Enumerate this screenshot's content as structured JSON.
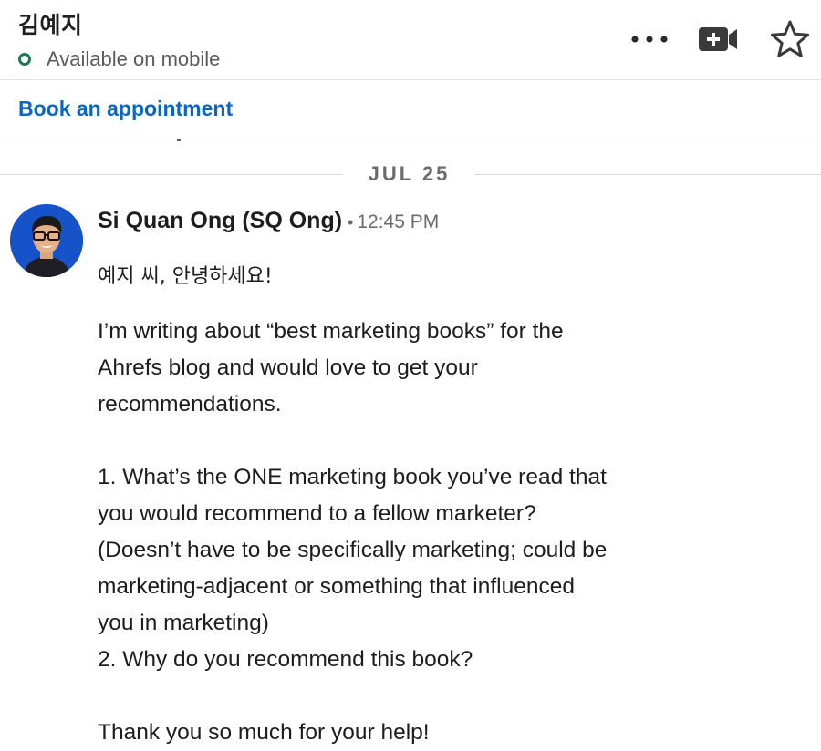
{
  "header": {
    "contact_name": "김예지",
    "status": "Available on mobile",
    "actions": {
      "more_icon": "more-horizontal-icon",
      "video_icon": "video-call-icon",
      "star_icon": "star-outline-icon"
    }
  },
  "book_bar": {
    "link_label": "Book an appointment"
  },
  "date_divider": {
    "label": "JUL 25"
  },
  "message": {
    "sender": "Si Quan Ong (SQ Ong)",
    "separator": "•",
    "time": "12:45 PM",
    "greeting": "예지 씨, 안녕하세요!",
    "paragraph1": [
      "I’m writing about “best marketing books” for the",
      "Ahrefs blog and would love to get your",
      "recommendations."
    ],
    "questions": [
      "1. What’s the ONE marketing book you’ve read that",
      "you would recommend to a fellow marketer?",
      "(Doesn’t have to be specifically marketing; could be",
      "marketing-adjacent or something that influenced",
      "you in marketing)",
      "2. Why do you recommend this book?"
    ],
    "closing": "Thank you so much for your help!"
  },
  "colors": {
    "link": "#0a66c2",
    "status_online": "#1f7a4d",
    "avatar_bg": "#1652c9"
  }
}
